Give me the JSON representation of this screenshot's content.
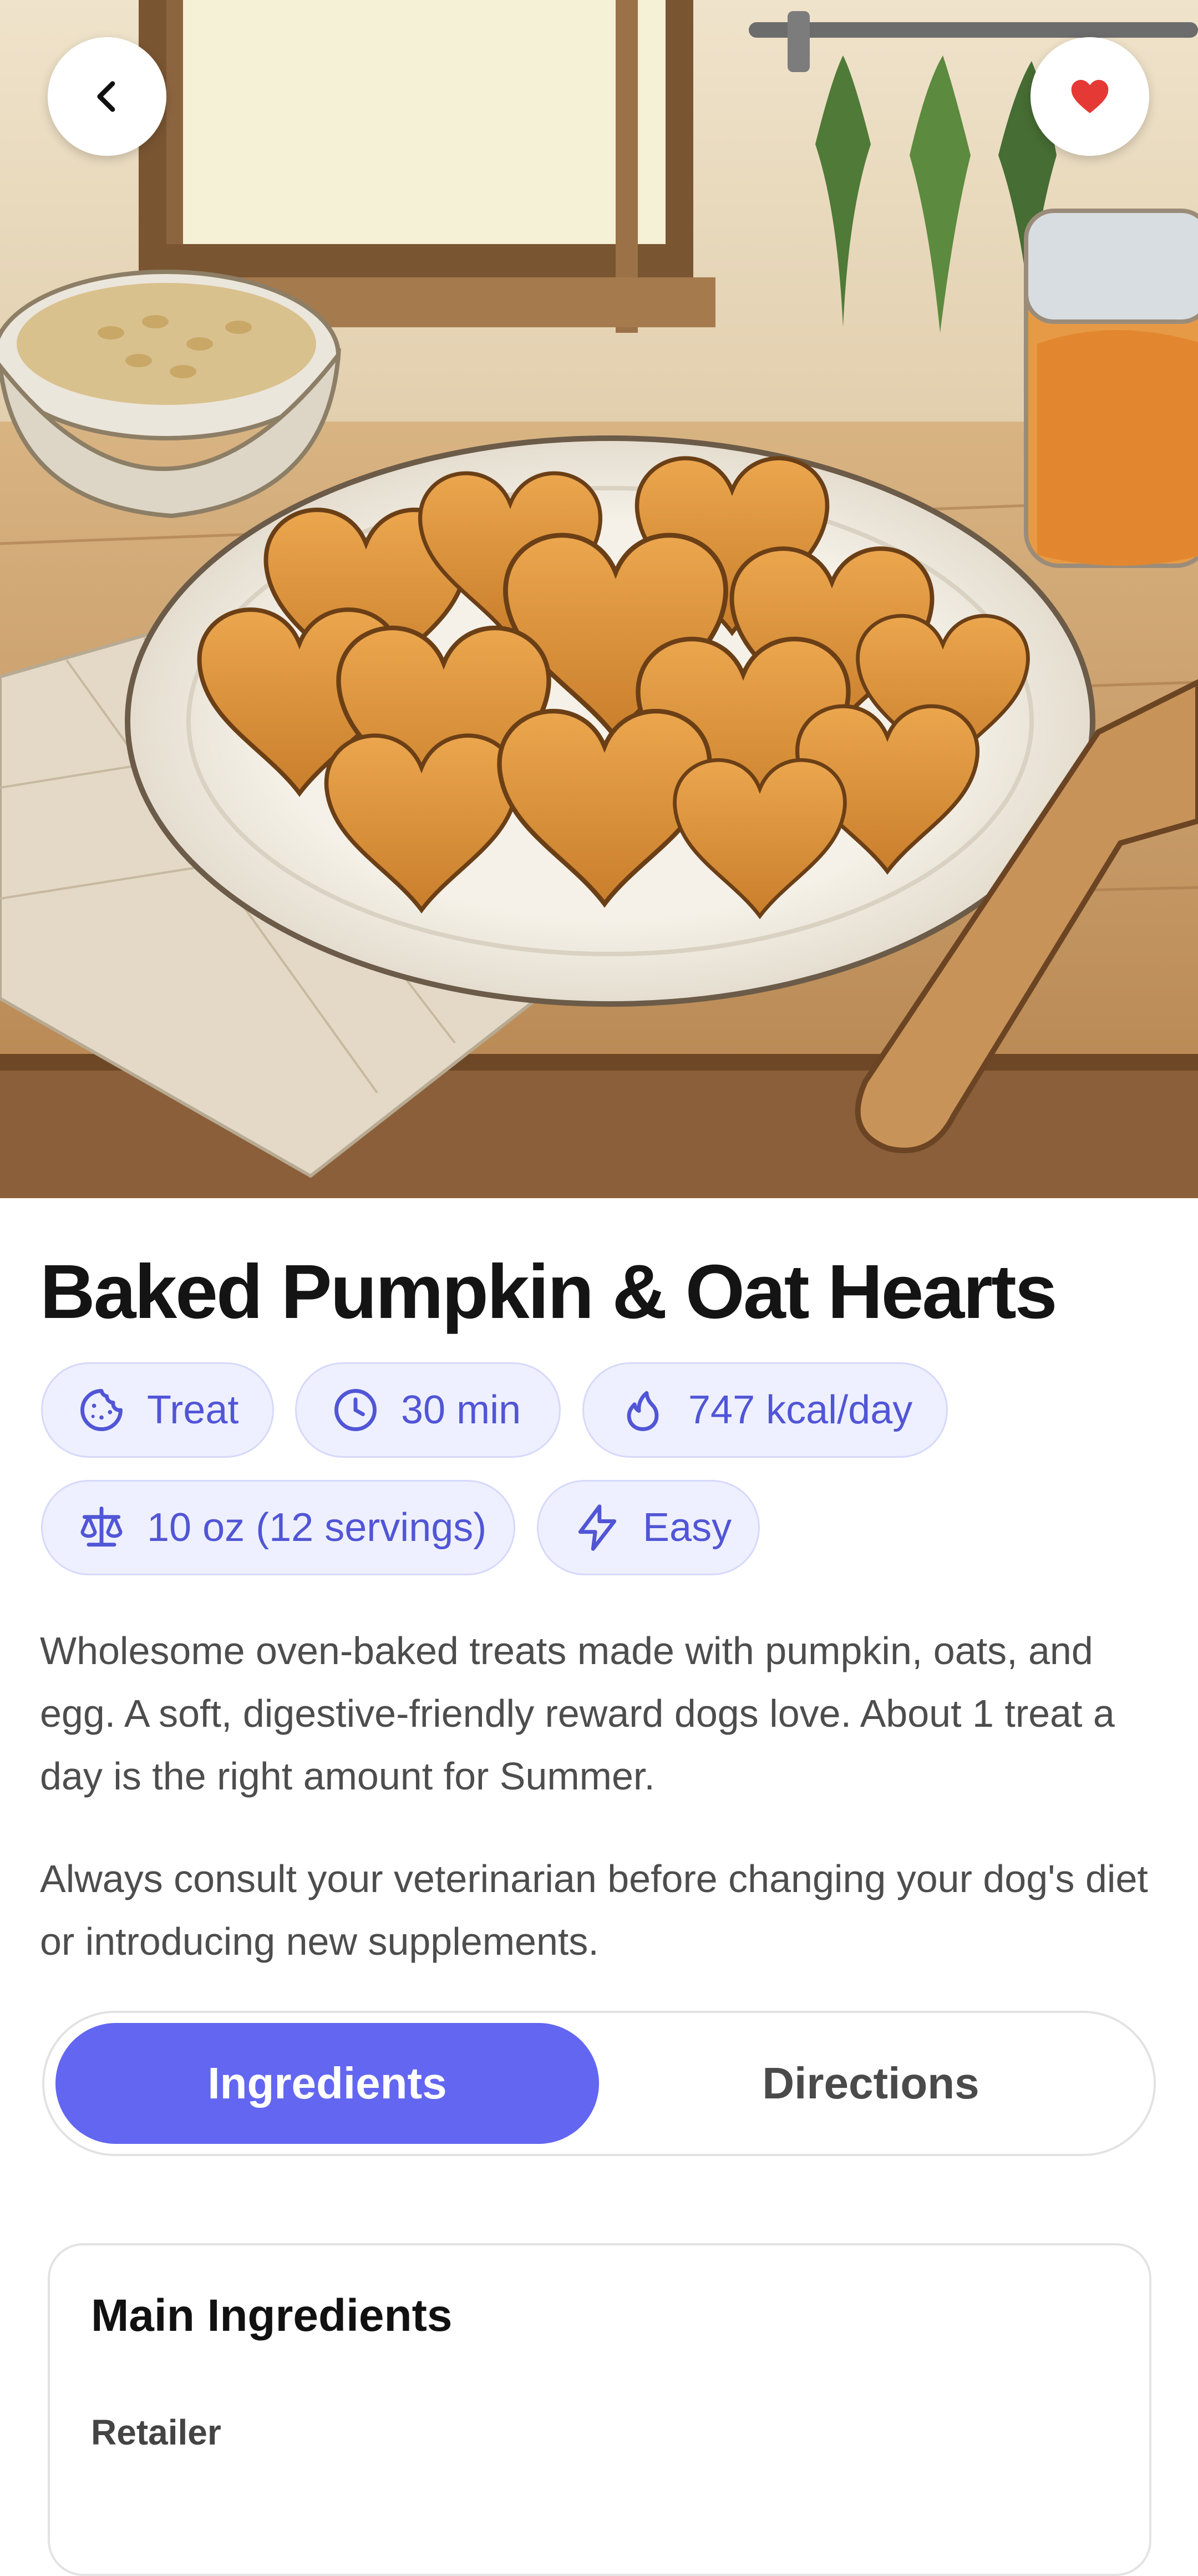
{
  "recipe": {
    "title": "Baked Pumpkin & Oat Hearts",
    "description": "Wholesome oven-baked treats made with pumpkin, oats, and egg. A soft, digestive-friendly reward dogs love. About 1 treat a day is the right amount for Summer.",
    "disclaimer": "Always consult your veterinarian before changing your dog's diet or introducing new supplements.",
    "favorited": true
  },
  "chips": [
    {
      "icon": "cookie-icon",
      "label": "Treat"
    },
    {
      "icon": "clock-icon",
      "label": "30 min"
    },
    {
      "icon": "flame-icon",
      "label": "747 kcal/day"
    },
    {
      "icon": "scale-icon",
      "label": "10 oz (12 servings)"
    },
    {
      "icon": "lightning-icon",
      "label": "Easy"
    }
  ],
  "tabs": {
    "items": [
      "Ingredients",
      "Directions"
    ],
    "active": "Ingredients"
  },
  "ingredients_card": {
    "title": "Main Ingredients",
    "subtitle": "Retailer"
  },
  "colors": {
    "accent": "#6366f1",
    "chip_bg": "#eef0ff",
    "chip_text": "#5155d6",
    "favorite": "#e53935"
  },
  "hero_image": "Illustration of heart-shaped pumpkin oat treats on a white plate on a wooden counter, with a bowl of oats, a jar of pumpkin puree, hanging herbs and a wooden spatula"
}
